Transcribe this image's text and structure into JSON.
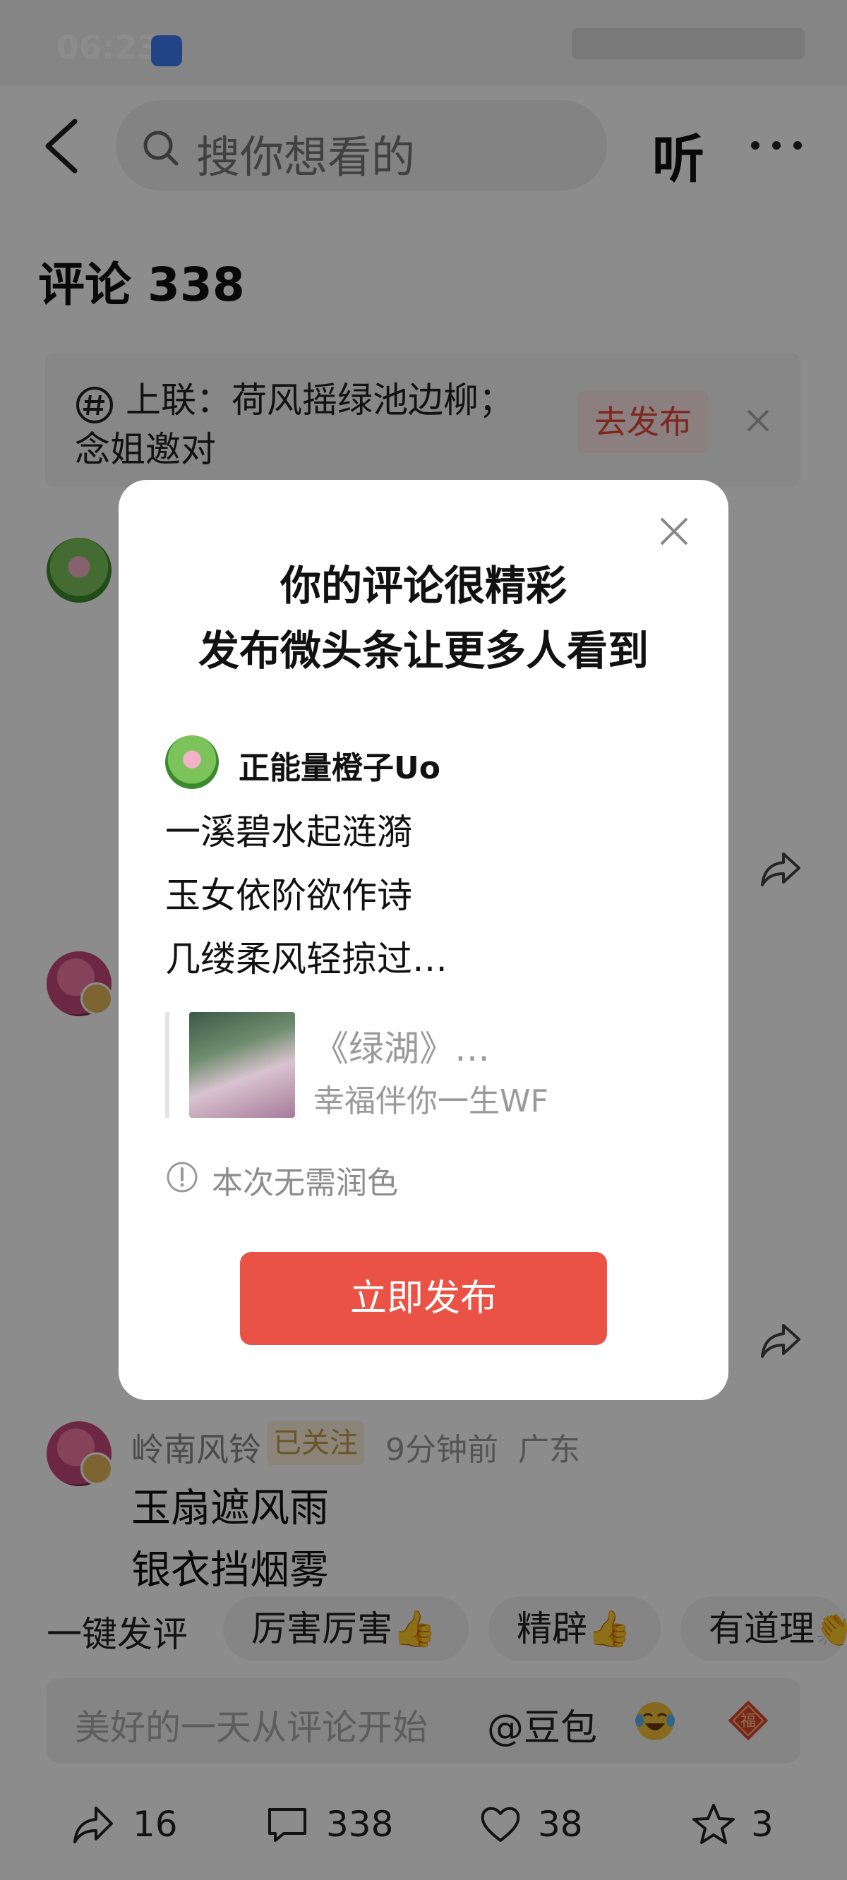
{
  "status": {
    "time": "06:23"
  },
  "search": {
    "placeholder": "搜你想看的",
    "listen_label": "听"
  },
  "comments_header": {
    "title": "评论 338"
  },
  "couplet_banner": {
    "line1": "上联：荷风摇绿池边柳；",
    "line2": "念姐邀对",
    "publish_label": "去发布"
  },
  "visible_comment": {
    "user": "岭南风铃",
    "follow_label": "已关注",
    "time": "9分钟前",
    "location": "广东",
    "lines": [
      "玉扇遮风雨",
      "银衣挡烟雾"
    ]
  },
  "quick_reply": {
    "label": "一键发评",
    "chips": [
      "厉害厉害👍",
      "精辟👍",
      "有道理👏"
    ]
  },
  "input": {
    "placeholder": "美好的一天从评论开始",
    "at_label": "@豆包"
  },
  "bottom_bar": {
    "share_count": "16",
    "comment_count": "338",
    "like_count": "38",
    "favorite_count": "3"
  },
  "modal": {
    "title_line1": "你的评论很精彩",
    "title_line2": "发布微头条让更多人看到",
    "user": "正能量橙子Uo",
    "lines": [
      "一溪碧水起涟漪",
      "玉女依阶欲作诗",
      "几缕柔风轻掠过…"
    ],
    "quote_title": "《绿湖》…",
    "quote_author": "幸福伴你一生WF",
    "note": "本次无需润色",
    "publish_button": "立即发布"
  },
  "icons": [
    "back-icon",
    "search-icon",
    "more-icon",
    "hashtag-icon",
    "close-icon",
    "share-icon",
    "comment-icon",
    "heart-icon",
    "star-icon",
    "emoji-icon",
    "fu-icon",
    "info-icon"
  ],
  "colors": {
    "accent_red": "#ea5246",
    "chip_red_bg": "#fde8e8",
    "follow_gold": "#c49a4a"
  }
}
